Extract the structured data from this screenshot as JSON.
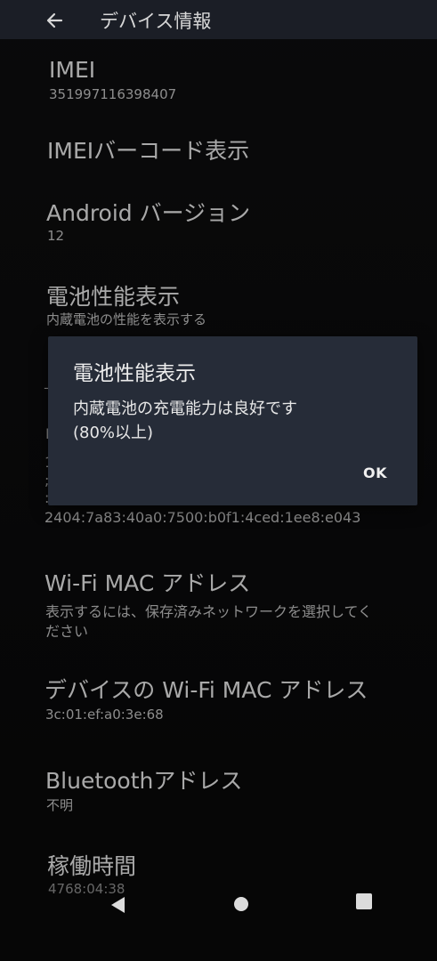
{
  "app_bar": {
    "title": "デバイス情報",
    "back_icon": "arrow-left-icon"
  },
  "items": {
    "imei": {
      "title": "IMEI",
      "value": "351997116398407"
    },
    "imei_barcode": {
      "title": "IMEIバーコード表示"
    },
    "android_version": {
      "title": "Android バージョン",
      "value": "12"
    },
    "battery": {
      "title": "電池性能表示",
      "value": "内蔵電池の性能を表示する"
    },
    "ip_address": {
      "value": "2404:7a83:40a0:7500:b0f1:4ced:1ee8:e043"
    },
    "wifi_mac": {
      "title": "Wi-Fi MAC アドレス",
      "value_line1": "表示するには、保存済みネットワークを選択してく",
      "value_line2": "ださい"
    },
    "device_wifi_mac": {
      "title": "デバイスの Wi-Fi MAC アドレス",
      "value": "3c:01:ef:a0:3e:68"
    },
    "bluetooth": {
      "title": "Bluetoothアドレス",
      "value": "不明"
    },
    "uptime": {
      "title": "稼働時間",
      "value": "4768:04:38"
    }
  },
  "dialog": {
    "title": "電池性能表示",
    "message_line1": "内蔵電池の充電能力は良好です",
    "message_line2": "(80%以上)",
    "ok_label": "OK"
  },
  "nav_bar": {
    "back_icon": "triangle-back-icon",
    "home_icon": "circle-home-icon",
    "recents_icon": "square-recents-icon"
  }
}
